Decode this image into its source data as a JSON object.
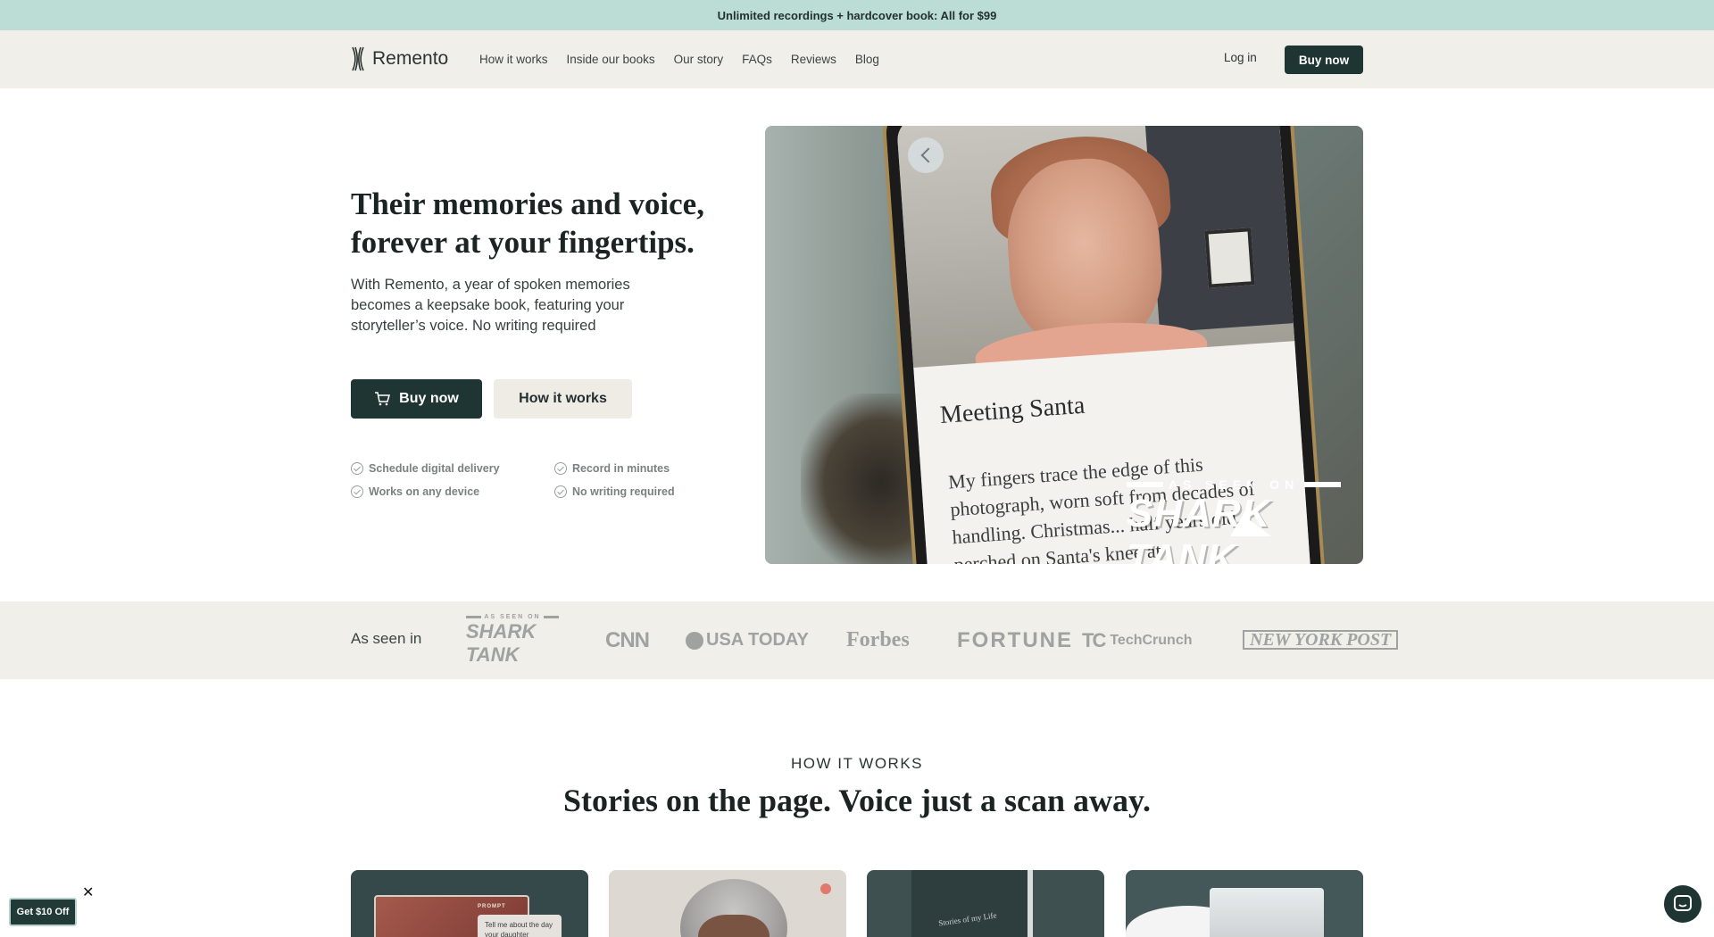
{
  "announcement": "Unlimited recordings + hardcover book: All for $99",
  "header": {
    "logo_text": "Remento",
    "nav": [
      "How it works",
      "Inside our books",
      "Our story",
      "FAQs",
      "Reviews",
      "Blog"
    ],
    "login": "Log in",
    "buy": "Buy now"
  },
  "hero": {
    "title_line1": "Their memories and voice,",
    "title_line2": "forever at your fingertips.",
    "subtitle": "With Remento, a year of spoken memories becomes a keepsake book, featuring your storyteller’s voice. No writing required",
    "buy": "Buy now",
    "how": "How it works",
    "features": [
      "Schedule digital delivery",
      "Record in minutes",
      "Works on any device",
      "No writing required"
    ],
    "media": {
      "story_title": "Meeting Santa",
      "story_text": "My fingers trace the edge of this photograph, worn soft from decades of handling. Christmas... half years old, perched on Santa's knee at",
      "badge_top": "AS SEEN ON",
      "badge_main": "SHARK TANK"
    }
  },
  "press": {
    "label": "As seen in",
    "shark_small": "AS SEEN ON",
    "shark_big": "SHARK TANK",
    "cnn": "CNN",
    "usa": "USA TODAY",
    "forbes": "Forbes",
    "fortune": "FORTUNE",
    "tc_mark": "TC",
    "tc": "TechCrunch",
    "nyp": "NEW YORK POST"
  },
  "how_it_works": {
    "eyebrow": "HOW IT WORKS",
    "title": "Stories on the page. Voice just a scan away.",
    "card1_prompt": "PROMPT",
    "card1_bubble": "Tell me about the day your daughter",
    "card3_book": "Stories of my Life"
  },
  "promo": {
    "label": "Get $10 Off",
    "close": "✕"
  },
  "colors": {
    "announce_bg": "#bcdcd6",
    "header_bg": "#f1efe9",
    "primary": "#1f3533"
  }
}
